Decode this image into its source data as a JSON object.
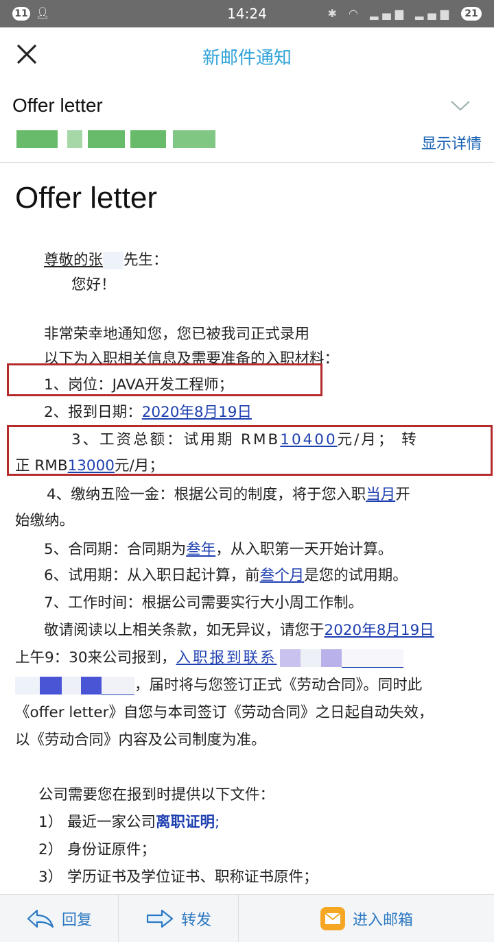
{
  "status_bar": {
    "time": "14:24",
    "badge_left": "11",
    "battery": "21"
  },
  "header": {
    "title": "新邮件通知"
  },
  "mail": {
    "subject": "Offer letter",
    "show_details": "显示详情"
  },
  "body": {
    "heading": "Offer letter",
    "greeting_prefix": "尊敬的张",
    "greeting_suffix": "先生：",
    "hello": "您好！",
    "intro1": "非常荣幸地通知您，您已被我司正式录用",
    "intro2": "以下为入职相关信息及需要准备的入职材料：",
    "item1": "1、岗位：JAVA开发工程师；",
    "item2_label": "2、报到日期：",
    "item2_date": "2020年8月19日",
    "item3_a": "3、工资总额：试用期 RMB",
    "item3_probation": "10400",
    "item3_b": "元/月； 转",
    "item3_c": "正 RMB",
    "item3_regular": "13000",
    "item3_d": "元/月；",
    "item4_a": "4、缴纳五险一金：根据公司的制度，将于您入职",
    "item4_link": "当月",
    "item4_b": "开",
    "item4_c": "始缴纳。",
    "item5_a": "5、合同期：合同期为",
    "item5_link": "叁年",
    "item5_b": "，从入职第一天开始计算。",
    "item6_a": "6、试用期：从入职日起计算，前",
    "item6_link": "叁个月",
    "item6_b": "是您的试用期。",
    "item7": "7、工作时间：根据公司需要实行大小周工作制。",
    "para_a": "敬请阅读以上相关条款，如无异议，请您于",
    "para_date": "2020年8月19日",
    "para_b": "上午9：30来公司报到，",
    "para_contact": "入职报到联系",
    "para_c": "，届时将与您签订正式《劳动合同》。同时此",
    "para_d": "《offer letter》自您与本司签订《劳动合同》之日起自动失效，",
    "para_e": "以《劳动合同》内容及公司制度为准。",
    "docs_intro": "公司需要您在报到时提供以下文件：",
    "doc1_a": "1）  最近一家公司",
    "doc1_link": "离职证明",
    "doc1_b": ";",
    "doc2": "2）  身份证原件；",
    "doc3": "3）  学历证书及学位证书、职称证书原件；"
  },
  "toolbar": {
    "reply": "回复",
    "forward": "转发",
    "open_mailbox": "进入邮箱"
  },
  "colors": {
    "accent": "#2fa3d8",
    "link": "#1e3fb0",
    "highlight_box": "#b52a2a",
    "mail_icon": "#f5a623"
  }
}
